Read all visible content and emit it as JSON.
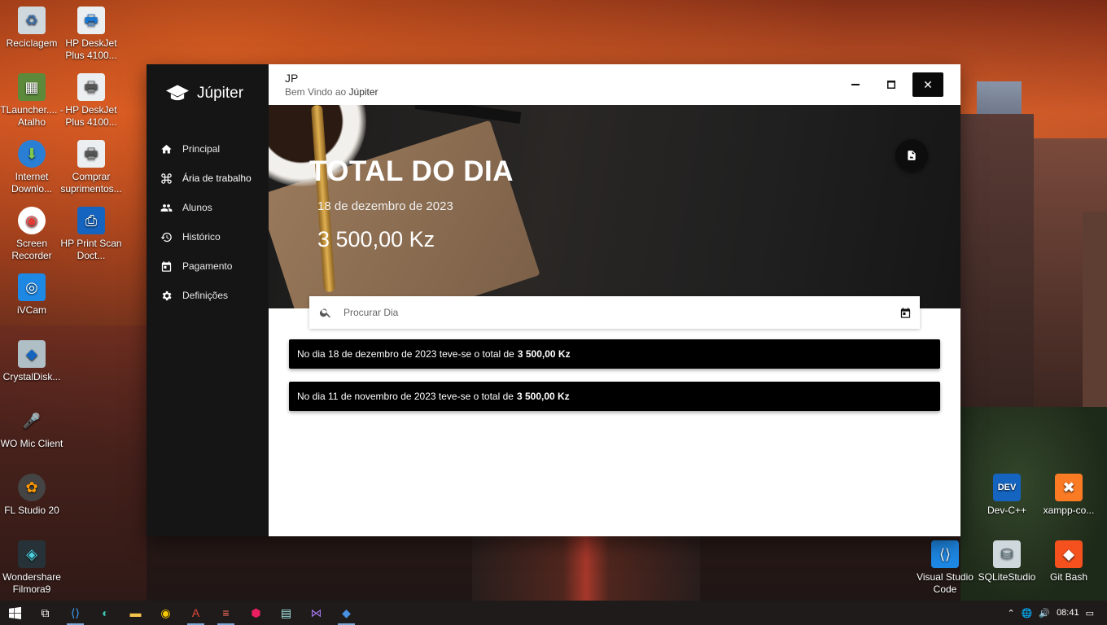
{
  "desktop": {
    "icons_left": [
      {
        "label": "Reciclagem",
        "icon": "recycle-bin-icon"
      },
      {
        "label": "TLauncher.... - Atalho",
        "icon": "tlauncher-icon"
      },
      {
        "label": "Internet Downlo...",
        "icon": "internet-download-icon"
      },
      {
        "label": "Screen Recorder",
        "icon": "screen-recorder-icon"
      },
      {
        "label": "iVCam",
        "icon": "ivcam-icon"
      },
      {
        "label": "CrystalDisk...",
        "icon": "crystaldisk-icon"
      },
      {
        "label": "WO Mic Client",
        "icon": "wo-mic-icon"
      },
      {
        "label": "FL Studio 20",
        "icon": "fl-studio-icon"
      },
      {
        "label": "Wondershare Filmora9",
        "icon": "filmora-icon"
      }
    ],
    "icons_left2": [
      {
        "label": "HP DeskJet Plus 4100...",
        "icon": "printer-icon"
      },
      {
        "label": "HP DeskJet Plus 4100...",
        "icon": "printer-icon"
      },
      {
        "label": "Comprar suprimentos...",
        "icon": "printer-supplies-icon"
      },
      {
        "label": "HP Print Scan Doct...",
        "icon": "hp-scan-icon"
      }
    ],
    "icons_right": [
      {
        "label": "Dev-C++",
        "icon": "devcpp-icon"
      },
      {
        "label": "xampp-co...",
        "icon": "xampp-icon"
      },
      {
        "label": "Visual Studio Code",
        "icon": "vscode-icon"
      },
      {
        "label": "SQLiteStudio",
        "icon": "sqlite-icon"
      },
      {
        "label": "Git Bash",
        "icon": "git-bash-icon"
      }
    ]
  },
  "app": {
    "brand": "Júpiter",
    "nav": [
      {
        "label": "Principal",
        "icon": "home-icon"
      },
      {
        "label": "Ária de trabalho",
        "icon": "command-icon"
      },
      {
        "label": "Alunos",
        "icon": "people-icon"
      },
      {
        "label": "Histórico",
        "icon": "history-icon"
      },
      {
        "label": "Pagamento",
        "icon": "calendar-icon"
      },
      {
        "label": "Definições",
        "icon": "gear-icon"
      }
    ],
    "header": {
      "title": "JP",
      "subtitle_prefix": "Bem Vindo ao",
      "subtitle_name": "Júpiter"
    },
    "window_controls": {
      "minimize": "−",
      "maximize": "□",
      "close": "✕"
    },
    "hero": {
      "title": "TOTAL DO DIA",
      "date": "18 de dezembro de 2023",
      "total": "3 500,00 Kz",
      "pdf_icon": "pdf-icon"
    },
    "search": {
      "placeholder": "Procurar Dia"
    },
    "records": [
      {
        "text": "No dia 18 de dezembro de 2023 teve-se o total de",
        "amount": "3 500,00 Kz"
      },
      {
        "text": "No dia 11 de novembro de 2023 teve-se o total de",
        "amount": "3 500,00 Kz"
      }
    ]
  },
  "taskbar": {
    "time": "08:41",
    "items": [
      "start-icon",
      "task-view-icon",
      "vscode-icon",
      "edge-icon",
      "file-explorer-icon",
      "app-icon",
      "access-icon",
      "stack-icon",
      "app-pink-icon",
      "notepad-icon",
      "visual-studio-icon",
      "app-blue-icon"
    ],
    "tray": [
      "chevron-up-icon",
      "globe-icon",
      "speaker-icon"
    ]
  }
}
